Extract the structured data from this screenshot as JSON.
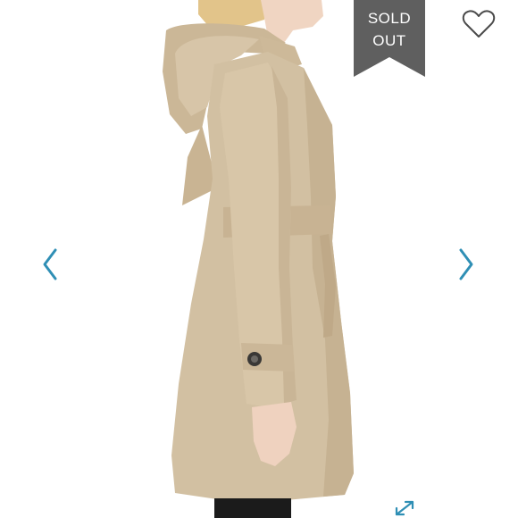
{
  "badge": {
    "line1": "SOLD",
    "line2": "OUT",
    "color": "#5f5f5f"
  },
  "icons": {
    "favorite": "heart-icon",
    "previous": "chevron-left-icon",
    "next": "chevron-right-icon",
    "expand": "expand-icon"
  },
  "colors": {
    "accent": "#2f8fb5",
    "coat": "#d2c0a2",
    "hair": "#e2c48a",
    "skin": "#f0d5c2"
  }
}
